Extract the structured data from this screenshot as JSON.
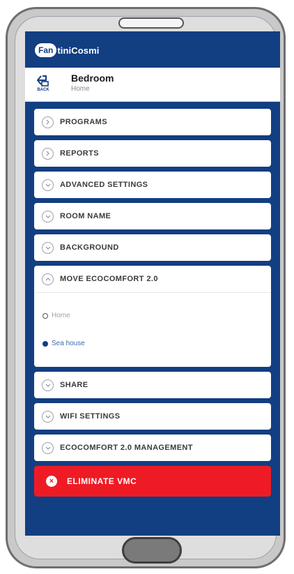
{
  "app": {
    "logo_badge": "Fan",
    "logo_rest": "tiniCosmi"
  },
  "header": {
    "back_label": "BACK",
    "title": "Bedroom",
    "subtitle": "Home"
  },
  "menu": {
    "programs": "PROGRAMS",
    "reports": "REPORTS",
    "advanced_settings": "ADVANCED SETTINGS",
    "room_name": "ROOM NAME",
    "background": "BACKGROUND",
    "move": "MOVE ECOCOMFORT 2.0",
    "share": "SHARE",
    "wifi": "WIFI SETTINGS",
    "management": "ECOCOMFORT 2.0 MANAGEMENT",
    "eliminate": "ELIMINATE VMC"
  },
  "move_options": [
    {
      "label": "Home",
      "selected": false
    },
    {
      "label": "Sea house",
      "selected": true
    }
  ],
  "colors": {
    "brand": "#123e82",
    "danger": "#ee1b24",
    "selected_text": "#3f6bb0",
    "unselected_text": "#a3a3a3"
  },
  "icons": {
    "collapsed": "chevron-right-icon",
    "expandable": "chevron-down-icon",
    "expanded": "chevron-up-icon"
  }
}
